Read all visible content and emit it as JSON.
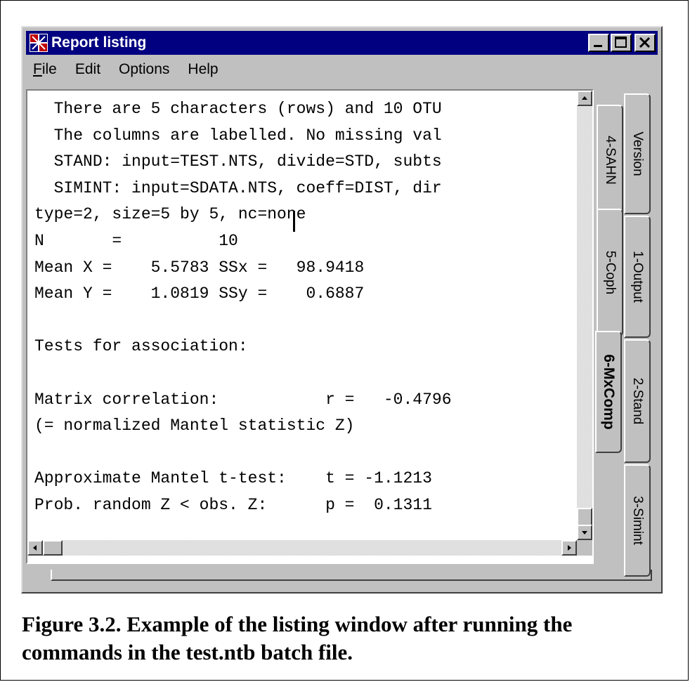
{
  "window": {
    "title": "Report listing",
    "minimize_icon": "minimize-icon",
    "maximize_icon": "maximize-icon",
    "close_icon": "close-icon",
    "app_icon": "app-icon"
  },
  "menu": {
    "items": [
      {
        "label": "File",
        "underline_first": true
      },
      {
        "label": "Edit",
        "underline_first": false
      },
      {
        "label": "Options",
        "underline_first": false
      },
      {
        "label": "Help",
        "underline_first": false
      }
    ]
  },
  "listing": {
    "lines": [
      "  There are 5 characters (rows) and 10 OTU",
      "  The columns are labelled. No missing val",
      "  STAND: input=TEST.NTS, divide=STD, subts",
      "  SIMINT: input=SDATA.NTS, coeff=DIST, dir",
      "type=2, size=5 by 5, nc=none",
      "N       =          10",
      "Mean X =    5.5783 SSx =   98.9418",
      "Mean Y =    1.0819 SSy =    0.6887",
      "",
      "Tests for association:",
      "",
      "Matrix correlation:           r =   -0.4796",
      "(= normalized Mantel statistic Z)",
      "",
      "Approximate Mantel t-test:    t = -1.1213",
      "Prob. random Z < obs. Z:      p =  0.1311"
    ]
  },
  "tabs": {
    "inner": [
      "4-SAHN",
      "5-Coph",
      "6-MxComp"
    ],
    "outer": [
      "Version",
      "1-Output",
      "2-Stand",
      "3-Simint"
    ],
    "active": "6-MxComp"
  },
  "caption": {
    "text": "Figure 3.2. Example of the listing window after running the commands in the test.ntb batch file."
  }
}
